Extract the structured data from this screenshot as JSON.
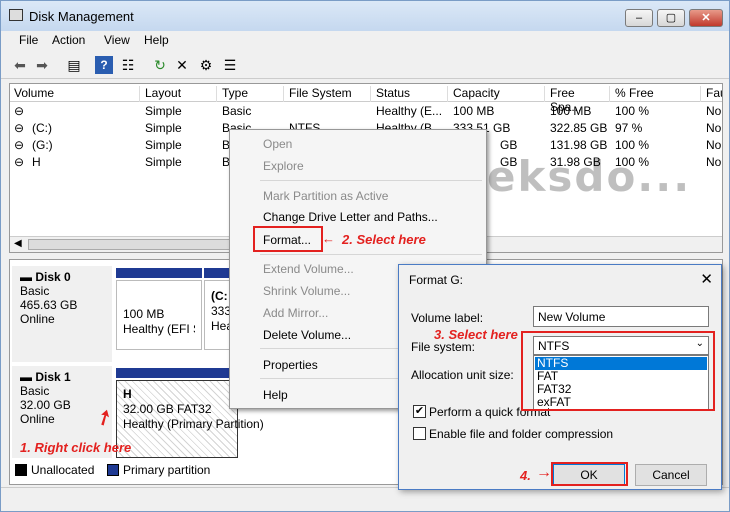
{
  "window": {
    "title": "Disk Management",
    "btn_min": "‒",
    "btn_max": "▢",
    "btn_close": "✕"
  },
  "menu": [
    "File",
    "Action",
    "View",
    "Help"
  ],
  "toolbar": {
    "back": "⬅",
    "forward": "➡",
    "view": "▤",
    "help": "?",
    "list": "☷",
    "refresh": "↻",
    "delete": "✕",
    "props": "⚙",
    "more": "☰"
  },
  "volumes": {
    "columns": [
      "Volume",
      "Layout",
      "Type",
      "File System",
      "Status",
      "Capacity",
      "Free Spa...",
      "% Free",
      "Fau"
    ],
    "rows": [
      [
        "",
        "Simple",
        "Basic",
        "",
        "Healthy (E...",
        "100 MB",
        "100 MB",
        "100 %",
        "No"
      ],
      [
        "(C:)",
        "Simple",
        "Basic",
        "NTFS",
        "Healthy (B...",
        "333.51 GB",
        "322.85 GB",
        "97 %",
        "No"
      ],
      [
        "(G:)",
        "Simple",
        "B",
        "",
        "",
        "GB",
        "131.98 GB",
        "100 %",
        "No"
      ],
      [
        "H",
        "Simple",
        "B",
        "",
        "",
        "GB",
        "31.98 GB",
        "100 %",
        "No"
      ]
    ]
  },
  "disks": [
    {
      "name": "Disk 0",
      "type": "Basic",
      "size": "465.63 GB",
      "state": "Online",
      "part1_size": "100 MB",
      "part1_status": "Healthy (EFI S",
      "part2_name": "(C:",
      "part2_size": "333.",
      "part2_status": "Hea"
    },
    {
      "name": "Disk 1",
      "type": "Basic",
      "size": "32.00 GB",
      "state": "Online",
      "part_name": "H",
      "part_size": "32.00 GB FAT32",
      "part_status": "Healthy (Primary Partition)"
    }
  ],
  "legend": {
    "unallocated": "Unallocated",
    "primary": "Primary partition"
  },
  "context_menu": {
    "open": "Open",
    "explore": "Explore",
    "mark_active": "Mark Partition as Active",
    "change_letter": "Change Drive Letter and Paths...",
    "format": "Format...",
    "extend": "Extend Volume...",
    "shrink": "Shrink Volume...",
    "mirror": "Add Mirror...",
    "delete": "Delete Volume...",
    "properties": "Properties",
    "help": "Help"
  },
  "annotations": {
    "step1": "1. Right click here",
    "step2": "2. Select here",
    "step3": "3. Select here",
    "step4": "4.",
    "watermark": "Geeksdo..."
  },
  "format_dialog": {
    "title": "Format G:",
    "close": "✕",
    "volume_label_lbl": "Volume label:",
    "volume_label": "New Volume",
    "fs_lbl": "File system:",
    "fs_value": "NTFS",
    "fs_options": [
      "NTFS",
      "FAT",
      "FAT32",
      "exFAT"
    ],
    "alloc_lbl": "Allocation unit size:",
    "quick_format": "Perform a quick format",
    "compression": "Enable file and folder compression",
    "check_mark": "✔",
    "ok": "OK",
    "cancel": "Cancel"
  }
}
